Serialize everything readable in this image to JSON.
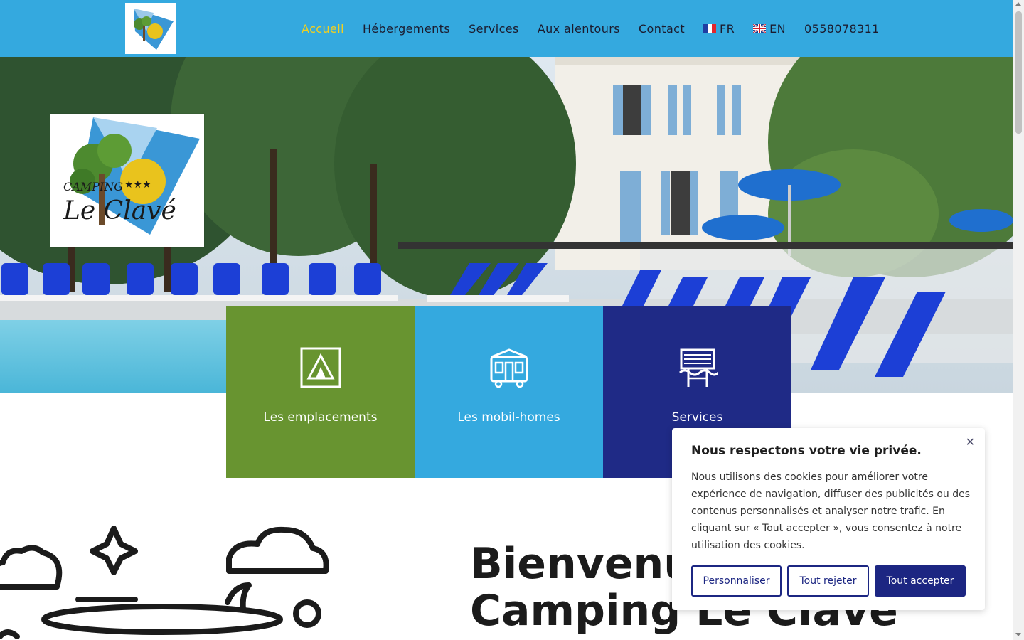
{
  "header": {
    "nav": [
      {
        "label": "Accueil",
        "active": true
      },
      {
        "label": "Hébergements"
      },
      {
        "label": "Services"
      },
      {
        "label": "Aux alentours"
      },
      {
        "label": "Contact"
      }
    ],
    "lang_fr": "FR",
    "lang_en": "EN",
    "phone": "0558078311",
    "logo_text_camping": "CAMPING",
    "logo_text_stars": "★★★",
    "logo_text_name": "Le Clavé"
  },
  "cards": [
    {
      "label": "Les emplacements",
      "color": "#689430",
      "icon": "tent-icon"
    },
    {
      "label": "Les mobil-homes",
      "color": "#34a9df",
      "icon": "mobile-home-icon"
    },
    {
      "label": "Services",
      "color": "#1f2a86",
      "icon": "pool-icon"
    }
  ],
  "welcome": {
    "line1": "Bienvenue",
    "line2": "Camping Le Clavé"
  },
  "cookie": {
    "title": "Nous respectons votre vie privée.",
    "body": "Nous utilisons des cookies pour améliorer votre expérience de navigation, diffuser des publicités ou des contenus personnalisés et analyser notre trafic. En cliquant sur « Tout accepter », vous consentez à notre utilisation des cookies.",
    "btn_customize": "Personnaliser",
    "btn_reject": "Tout rejeter",
    "btn_accept": "Tout accepter"
  },
  "colors": {
    "header_bg": "#34a9df",
    "active_nav": "#f2d01f",
    "primary_button": "#1c2682"
  }
}
